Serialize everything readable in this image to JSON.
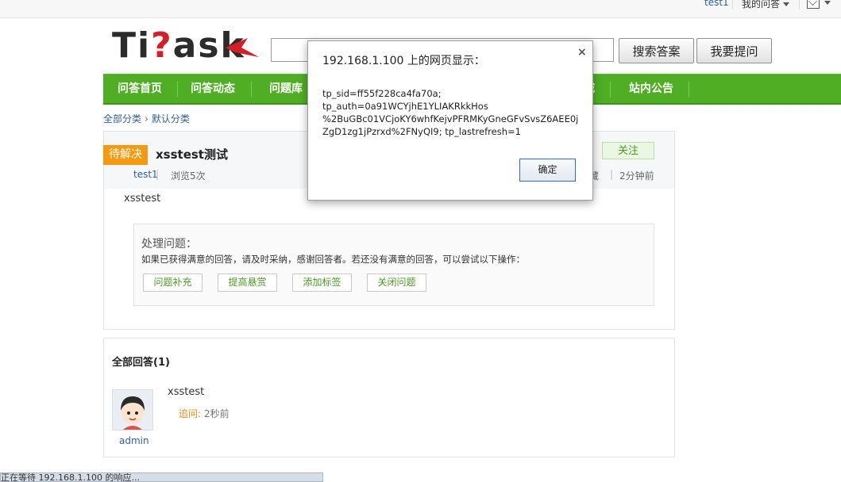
{
  "topbar": {
    "user": "test1",
    "my_qa": "我的问答",
    "mail_icon": "envelope-icon"
  },
  "logo": {
    "text_a": "Ti",
    "text_q": "?",
    "text_b": "ask"
  },
  "search": {
    "placeholder": "",
    "button": "搜索答案"
  },
  "ask_button": "我要提问",
  "nav": {
    "items": [
      "问答首页",
      "问答动态",
      "问题库",
      "城",
      "站内公告"
    ],
    "accent": "#4fae23"
  },
  "breadcrumb": {
    "root": "全部分类",
    "current": "默认分类"
  },
  "question": {
    "status": "待解决",
    "title": "xsstest测试",
    "author": "test1",
    "views": "浏览5次",
    "follow": "关注",
    "fav": "藏",
    "time": "2分钟前",
    "body": "xsstest",
    "handle_title": "处理问题：",
    "handle_tip": "如果已获得满意的回答，请及时采纳，感谢回答者。若还没有满意的回答，可以尝试以下操作：",
    "handle_buttons": [
      "问题补充",
      "提高悬赏",
      "添加标签",
      "关闭问题"
    ]
  },
  "answers": {
    "header": "全部回答(1)",
    "items": [
      {
        "user": "admin",
        "text": "xsstest",
        "followup": "追问:",
        "time": "2秒前"
      }
    ]
  },
  "statusbar": {
    "text": "正在等待 192.168.1.100 的响应..."
  },
  "dialog": {
    "title": "192.168.1.100 上的网页显示：",
    "message": "tp_sid=ff55f228ca4fa70a;\ntp_auth=0a91WCYjhE1YLIAKRkkHos\n%2BuGBc01VCjoKY6whfKejvPFRMKyGneGFvSvsZ6AEE0j\nZgD1zg1jPzrxd%2FNyQI9; tp_lastrefresh=1",
    "ok": "确定",
    "close": "×"
  }
}
